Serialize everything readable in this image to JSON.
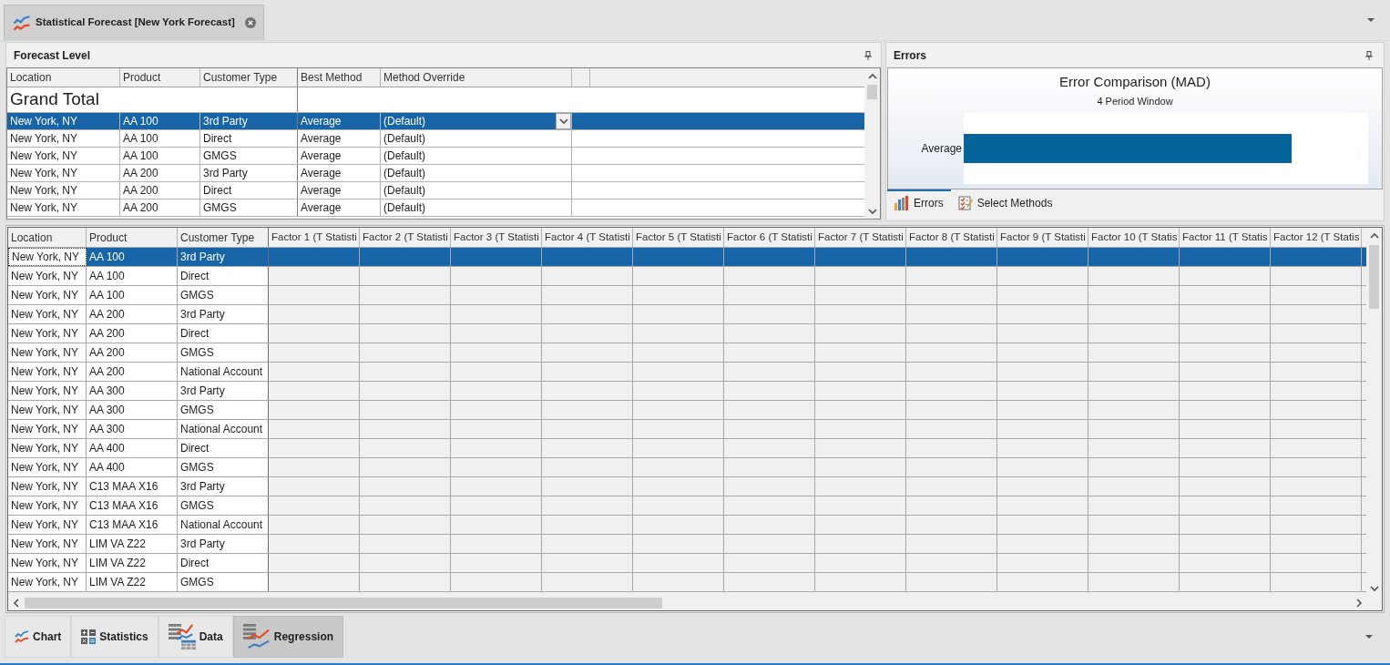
{
  "document_tabs": [
    {
      "title": "Statistical Forecast [New York Forecast]",
      "selected": true
    }
  ],
  "forecast_level": {
    "title": "Forecast Level",
    "columns": [
      "Location",
      "Product",
      "Customer Type",
      "Best Method",
      "Method Override"
    ],
    "grand_total": "Grand Total",
    "rows": [
      {
        "location": "New York, NY",
        "product": "AA 100",
        "customer_type": "3rd Party",
        "best_method": "Average",
        "method_override": "(Default)",
        "selected": true
      },
      {
        "location": "New York, NY",
        "product": "AA 100",
        "customer_type": "Direct",
        "best_method": "Average",
        "method_override": "(Default)",
        "selected": false
      },
      {
        "location": "New York, NY",
        "product": "AA 100",
        "customer_type": "GMGS",
        "best_method": "Average",
        "method_override": "(Default)",
        "selected": false
      },
      {
        "location": "New York, NY",
        "product": "AA 200",
        "customer_type": "3rd Party",
        "best_method": "Average",
        "method_override": "(Default)",
        "selected": false
      },
      {
        "location": "New York, NY",
        "product": "AA 200",
        "customer_type": "Direct",
        "best_method": "Average",
        "method_override": "(Default)",
        "selected": false
      },
      {
        "location": "New York, NY",
        "product": "AA 200",
        "customer_type": "GMGS",
        "best_method": "Average",
        "method_override": "(Default)",
        "selected": false
      }
    ]
  },
  "errors": {
    "title": "Errors",
    "chart_title": "Error Comparison (MAD)",
    "chart_subtitle": "4 Period Window",
    "bar_labels": [
      "Average"
    ],
    "tabs": [
      {
        "label": "Errors",
        "selected": true
      },
      {
        "label": "Select Methods",
        "selected": false
      }
    ]
  },
  "regression_grid": {
    "columns": [
      "Location",
      "Product",
      "Customer Type",
      "Factor 1 (T Statisti",
      "Factor 2 (T Statisti",
      "Factor 3 (T Statisti",
      "Factor 4 (T Statisti",
      "Factor 5 (T Statisti",
      "Factor 6 (T Statisti",
      "Factor 7 (T Statisti",
      "Factor 8 (T Statisti",
      "Factor 9 (T Statisti",
      "Factor 10 (T Statis",
      "Factor 11 (T Statis",
      "Factor 12 (T Statis"
    ],
    "rows": [
      {
        "location": "New York, NY",
        "product": "AA 100",
        "customer_type": "3rd Party",
        "selected": true,
        "focused": true
      },
      {
        "location": "New York, NY",
        "product": "AA 100",
        "customer_type": "Direct",
        "selected": false,
        "focused": false
      },
      {
        "location": "New York, NY",
        "product": "AA 100",
        "customer_type": "GMGS",
        "selected": false,
        "focused": false
      },
      {
        "location": "New York, NY",
        "product": "AA 200",
        "customer_type": "3rd Party",
        "selected": false,
        "focused": false
      },
      {
        "location": "New York, NY",
        "product": "AA 200",
        "customer_type": "Direct",
        "selected": false,
        "focused": false
      },
      {
        "location": "New York, NY",
        "product": "AA 200",
        "customer_type": "GMGS",
        "selected": false,
        "focused": false
      },
      {
        "location": "New York, NY",
        "product": "AA 200",
        "customer_type": "National Account",
        "selected": false,
        "focused": false
      },
      {
        "location": "New York, NY",
        "product": "AA 300",
        "customer_type": "3rd Party",
        "selected": false,
        "focused": false
      },
      {
        "location": "New York, NY",
        "product": "AA 300",
        "customer_type": "GMGS",
        "selected": false,
        "focused": false
      },
      {
        "location": "New York, NY",
        "product": "AA 300",
        "customer_type": "National Account",
        "selected": false,
        "focused": false
      },
      {
        "location": "New York, NY",
        "product": "AA 400",
        "customer_type": "Direct",
        "selected": false,
        "focused": false
      },
      {
        "location": "New York, NY",
        "product": "AA 400",
        "customer_type": "GMGS",
        "selected": false,
        "focused": false
      },
      {
        "location": "New York, NY",
        "product": "C13 MAA X16",
        "customer_type": "3rd Party",
        "selected": false,
        "focused": false
      },
      {
        "location": "New York, NY",
        "product": "C13 MAA X16",
        "customer_type": "GMGS",
        "selected": false,
        "focused": false
      },
      {
        "location": "New York, NY",
        "product": "C13 MAA X16",
        "customer_type": "National Account",
        "selected": false,
        "focused": false
      },
      {
        "location": "New York, NY",
        "product": "LIM VA Z22",
        "customer_type": "3rd Party",
        "selected": false,
        "focused": false
      },
      {
        "location": "New York, NY",
        "product": "LIM VA Z22",
        "customer_type": "Direct",
        "selected": false,
        "focused": false
      },
      {
        "location": "New York, NY",
        "product": "LIM VA Z22",
        "customer_type": "GMGS",
        "selected": false,
        "focused": false
      }
    ]
  },
  "view_tabs": [
    {
      "label": "Chart",
      "selected": false
    },
    {
      "label": "Statistics",
      "selected": false
    },
    {
      "label": "Data",
      "selected": false
    },
    {
      "label": "Regression",
      "selected": true
    }
  ]
}
